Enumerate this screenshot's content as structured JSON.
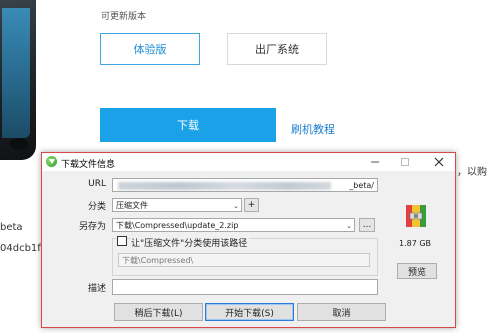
{
  "page": {
    "updatable_version_label": "可更新版本",
    "options": [
      {
        "label": "体验版",
        "active": true
      },
      {
        "label": "出厂系统",
        "active": false
      }
    ],
    "download_button": "下载",
    "flash_tutorial_link": "刷机教程",
    "side_text_right": "，以购",
    "side_text_left_1": "beta",
    "side_text_left_2": "04dcb1f",
    "accent_color": "#1aa1e8"
  },
  "dialog": {
    "title": "下载文件信息",
    "window_controls": [
      "minimize-icon",
      "maximize-icon",
      "close-icon"
    ],
    "url": {
      "label": "URL",
      "value_tail": "_beta/"
    },
    "category": {
      "label": "分类",
      "value": "压缩文件",
      "add_button": "+"
    },
    "save_as": {
      "label": "另存为",
      "value": "下载\\Compressed\\update_2.zip",
      "browse_button": "..."
    },
    "use_path_checkbox": {
      "label": "让\"压缩文件\"分类使用该路径",
      "checked": false,
      "path_value": "下载\\Compressed\\"
    },
    "file_icon": "zip-archive-icon",
    "file_size": "1.87  GB",
    "preview_button": "预览",
    "description": {
      "label": "描述",
      "value": ""
    },
    "buttons": {
      "download_later": "稍后下载(L)",
      "start_download": "开始下载(S)",
      "cancel": "取消"
    },
    "border_color": "#d84a4a"
  }
}
